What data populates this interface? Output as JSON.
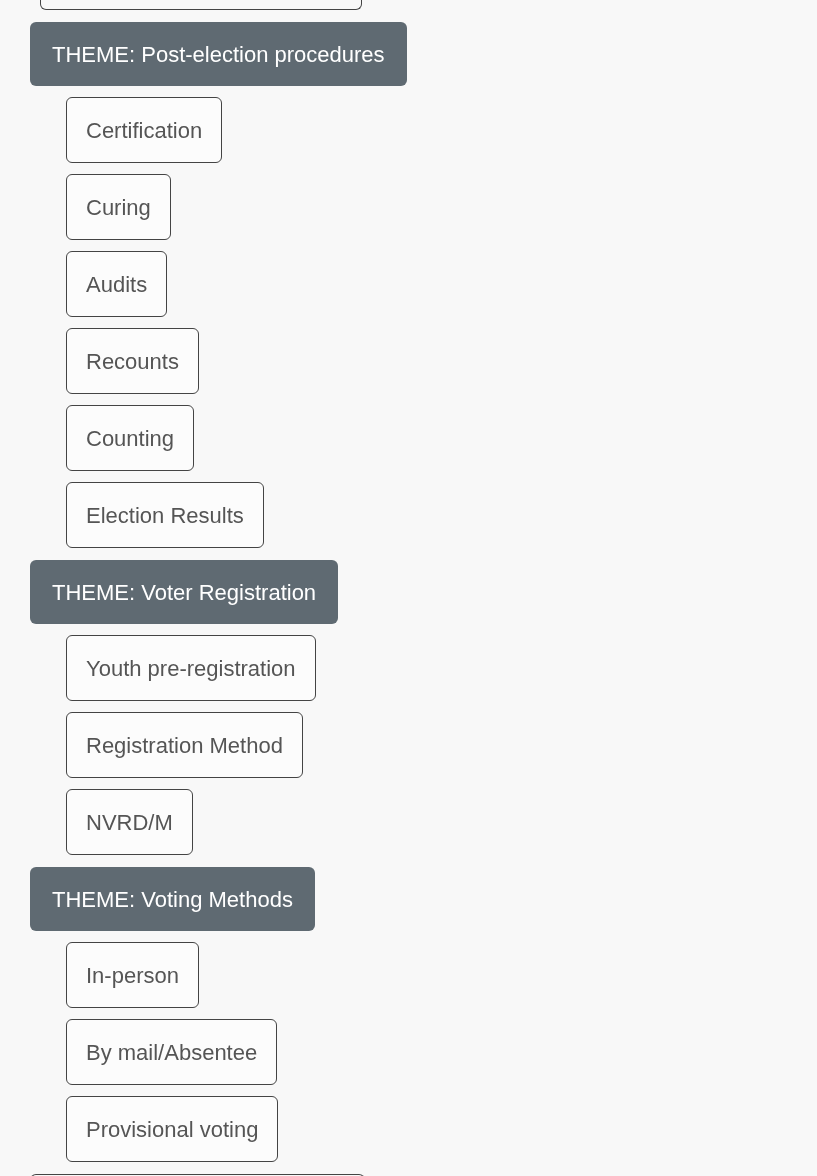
{
  "themes": [
    {
      "title": "THEME: Post-election procedures",
      "topics": [
        "Certification",
        "Curing",
        "Audits",
        "Recounts",
        "Counting",
        "Election Results"
      ]
    },
    {
      "title": "THEME: Voter Registration",
      "topics": [
        "Youth pre-registration",
        "Registration Method",
        "NVRD/M"
      ]
    },
    {
      "title": "THEME: Voting Methods",
      "topics": [
        "In-person",
        "By mail/Absentee",
        "Provisional voting"
      ]
    }
  ]
}
